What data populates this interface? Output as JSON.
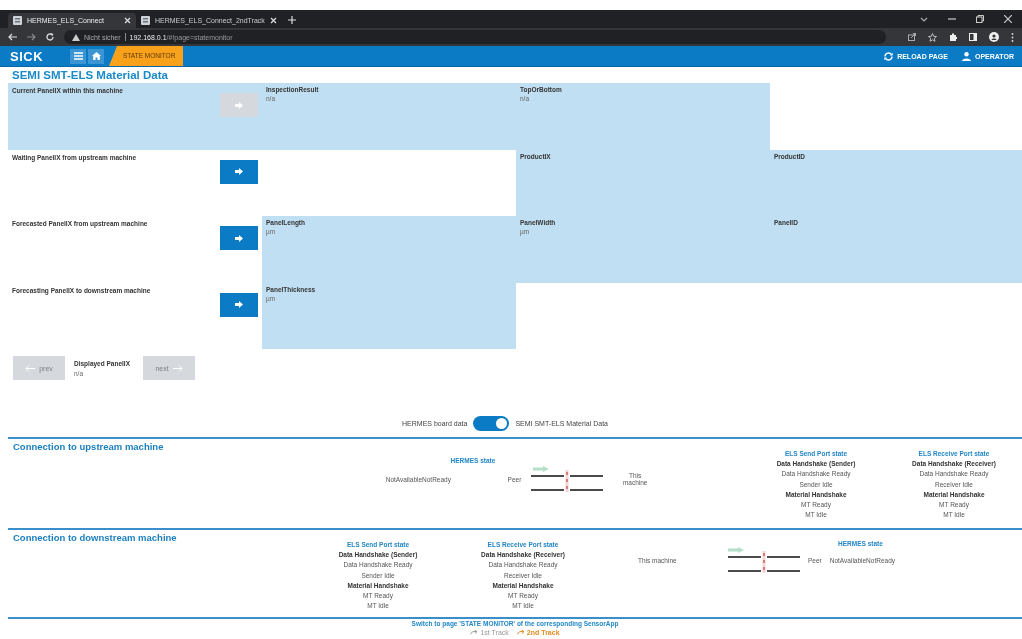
{
  "browser": {
    "tabs": [
      {
        "title": "HERMES_ELS_Connect",
        "selected": true
      },
      {
        "title": "HERMES_ELS_Connect_2ndTrack",
        "selected": false
      }
    ],
    "address": {
      "security": "Nicht sicher",
      "host": "192.168.0.1",
      "path": "/#!page=statemonitor"
    }
  },
  "app_header": {
    "logo": "SICK",
    "breadcrumb": "STATE MONITOR",
    "actions": [
      {
        "label": "RELOAD PAGE",
        "kind": "reload"
      },
      {
        "label": "OPERATOR",
        "kind": "user"
      }
    ]
  },
  "page_title": "SEMI SMT-ELS Material Data",
  "panel_rows": [
    {
      "label": "Current PanelIX within this machine",
      "highlighted": true,
      "arrow_disabled": true,
      "fields": [
        {
          "kind": "field",
          "name": "InspectionResult",
          "value": "n/a"
        },
        {
          "kind": "field",
          "name": "TopOrBottom",
          "value": "n/a"
        },
        {
          "kind": "empty"
        }
      ]
    },
    {
      "label": "Waiting PanelIX from upstream machine",
      "highlighted": false,
      "arrow_disabled": false,
      "fields": [
        {
          "kind": "empty"
        },
        {
          "kind": "field",
          "name": "ProductIX"
        },
        {
          "kind": "field",
          "name": "ProductID"
        }
      ]
    },
    {
      "label": "Forecasted PanelIX from upstream machine",
      "highlighted": false,
      "arrow_disabled": false,
      "fields": [
        {
          "kind": "field",
          "name": "PanelLength",
          "value": "µm"
        },
        {
          "kind": "field",
          "name": "PanelWidth",
          "value": "µm"
        },
        {
          "kind": "field",
          "name": "PanelID"
        }
      ]
    },
    {
      "label": "Forecasting PanelIX to downstream machine",
      "highlighted": false,
      "arrow_disabled": false,
      "fields": [
        {
          "kind": "field",
          "name": "PanelThickness",
          "value": "µm"
        },
        {
          "kind": "empty"
        },
        {
          "kind": "empty"
        }
      ]
    }
  ],
  "navigation": {
    "prev": {
      "label": "prev",
      "disabled": true
    },
    "displayed_label": "Displayed PanelIX",
    "displayed_value": "n/a",
    "next": {
      "label": "next",
      "disabled": true
    }
  },
  "view_toggle": {
    "left_label": "HERMES board data",
    "on": true,
    "right_label": "SEMI SMT-ELS Material Data"
  },
  "connections": [
    {
      "title": "Connection to upstream machine",
      "blocks": [
        {
          "kind": "hermes",
          "title": "HERMES state",
          "state": "NotAvailableNotReady",
          "peer": "Peer",
          "self": "This machine",
          "mirrored": false
        },
        {
          "kind": "port",
          "title": "ELS Send Port state",
          "groups": [
            {
              "heading": "Data Handshake (Sender)",
              "values": [
                "Data Handshake Ready",
                "Sender Idle"
              ]
            },
            {
              "heading": "Material Handshake",
              "values": [
                "MT Ready",
                "MT Idle"
              ]
            }
          ]
        },
        {
          "kind": "port",
          "title": "ELS Receive Port state",
          "groups": [
            {
              "heading": "Data Handshake (Receiver)",
              "values": [
                "Data Handshake Ready",
                "Receiver Idle"
              ]
            },
            {
              "heading": "Material Handshake",
              "values": [
                "MT Ready",
                "MT Idle"
              ]
            }
          ]
        }
      ]
    },
    {
      "title": "Connection to downstream machine",
      "blocks": [
        {
          "kind": "port",
          "title": "ELS Send Port state",
          "groups": [
            {
              "heading": "Data Handshake (Sender)",
              "values": [
                "Data Handshake Ready",
                "Sender Idle"
              ]
            },
            {
              "heading": "Material Handshake",
              "values": [
                "MT Ready",
                "MT Idle"
              ]
            }
          ]
        },
        {
          "kind": "port",
          "title": "ELS Receive Port state",
          "groups": [
            {
              "heading": "Data Handshake (Receiver)",
              "values": [
                "Data Handshake Ready",
                "Receiver Idle"
              ]
            },
            {
              "heading": "Material Handshake",
              "values": [
                "MT Ready",
                "MT Idle"
              ]
            }
          ]
        },
        {
          "kind": "hermes",
          "title": "HERMES state",
          "state": "NotAvailableNotReady",
          "peer": "Peer",
          "self": "This machine",
          "mirrored": true
        }
      ]
    }
  ],
  "footer": {
    "text": "Switch to page 'STATE MONITOR' of the corresponding SensorApp",
    "tracks": [
      {
        "label": "1st Track",
        "selected": false
      },
      {
        "label": "2nd Track",
        "selected": true
      }
    ]
  }
}
